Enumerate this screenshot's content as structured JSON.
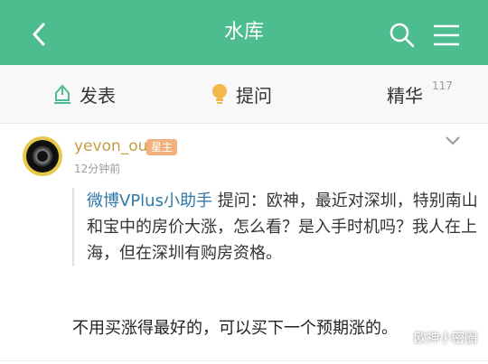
{
  "header": {
    "title": "水库"
  },
  "tabs": [
    {
      "label": "发表"
    },
    {
      "label": "提问"
    },
    {
      "label": "精华",
      "count": "117"
    }
  ],
  "post": {
    "username": "yevon_ou",
    "badge": "星主",
    "time": "12分钟前",
    "question": {
      "asker": "微博VPlus小助手",
      "prefix": " 提问：",
      "text": "欧神，最近对深圳，特别南山和宝中的房价大涨，怎么看？是入手时机吗？我人在上海，但在深圳有购房资格。"
    },
    "answer": "不用买涨得最好的，可以买下一个预期涨的。"
  },
  "watermark": {
    "text": "欧神小密圈"
  },
  "colors": {
    "header": "#4dbc8f",
    "asker": "#2f78a8",
    "username": "#c79a45",
    "badge": "#f2b17a"
  }
}
